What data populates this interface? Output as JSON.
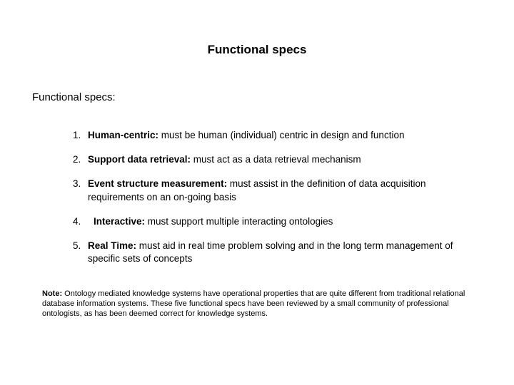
{
  "title": "Functional specs",
  "subtitle": "Functional specs:",
  "items": [
    {
      "label": "Human-centric:",
      "text": " must be human (individual) centric in design and function"
    },
    {
      "label": "Support data retrieval:",
      "text": " must act as a data retrieval mechanism"
    },
    {
      "label": "Event structure measurement:",
      "text": " must assist in the definition of data acquisition requirements on an on-going basis"
    },
    {
      "label": "Interactive:",
      "text": " must support multiple interacting ontologies"
    },
    {
      "label": "Real Time:",
      "text": " must aid in real time problem solving and in the long term management of specific sets of concepts"
    }
  ],
  "note": {
    "label": "Note:",
    "text": " Ontology mediated knowledge systems have operational properties that are quite different from traditional relational database information systems. These five functional specs have been reviewed by a small community of professional ontologists, as has been deemed correct for knowledge systems."
  }
}
